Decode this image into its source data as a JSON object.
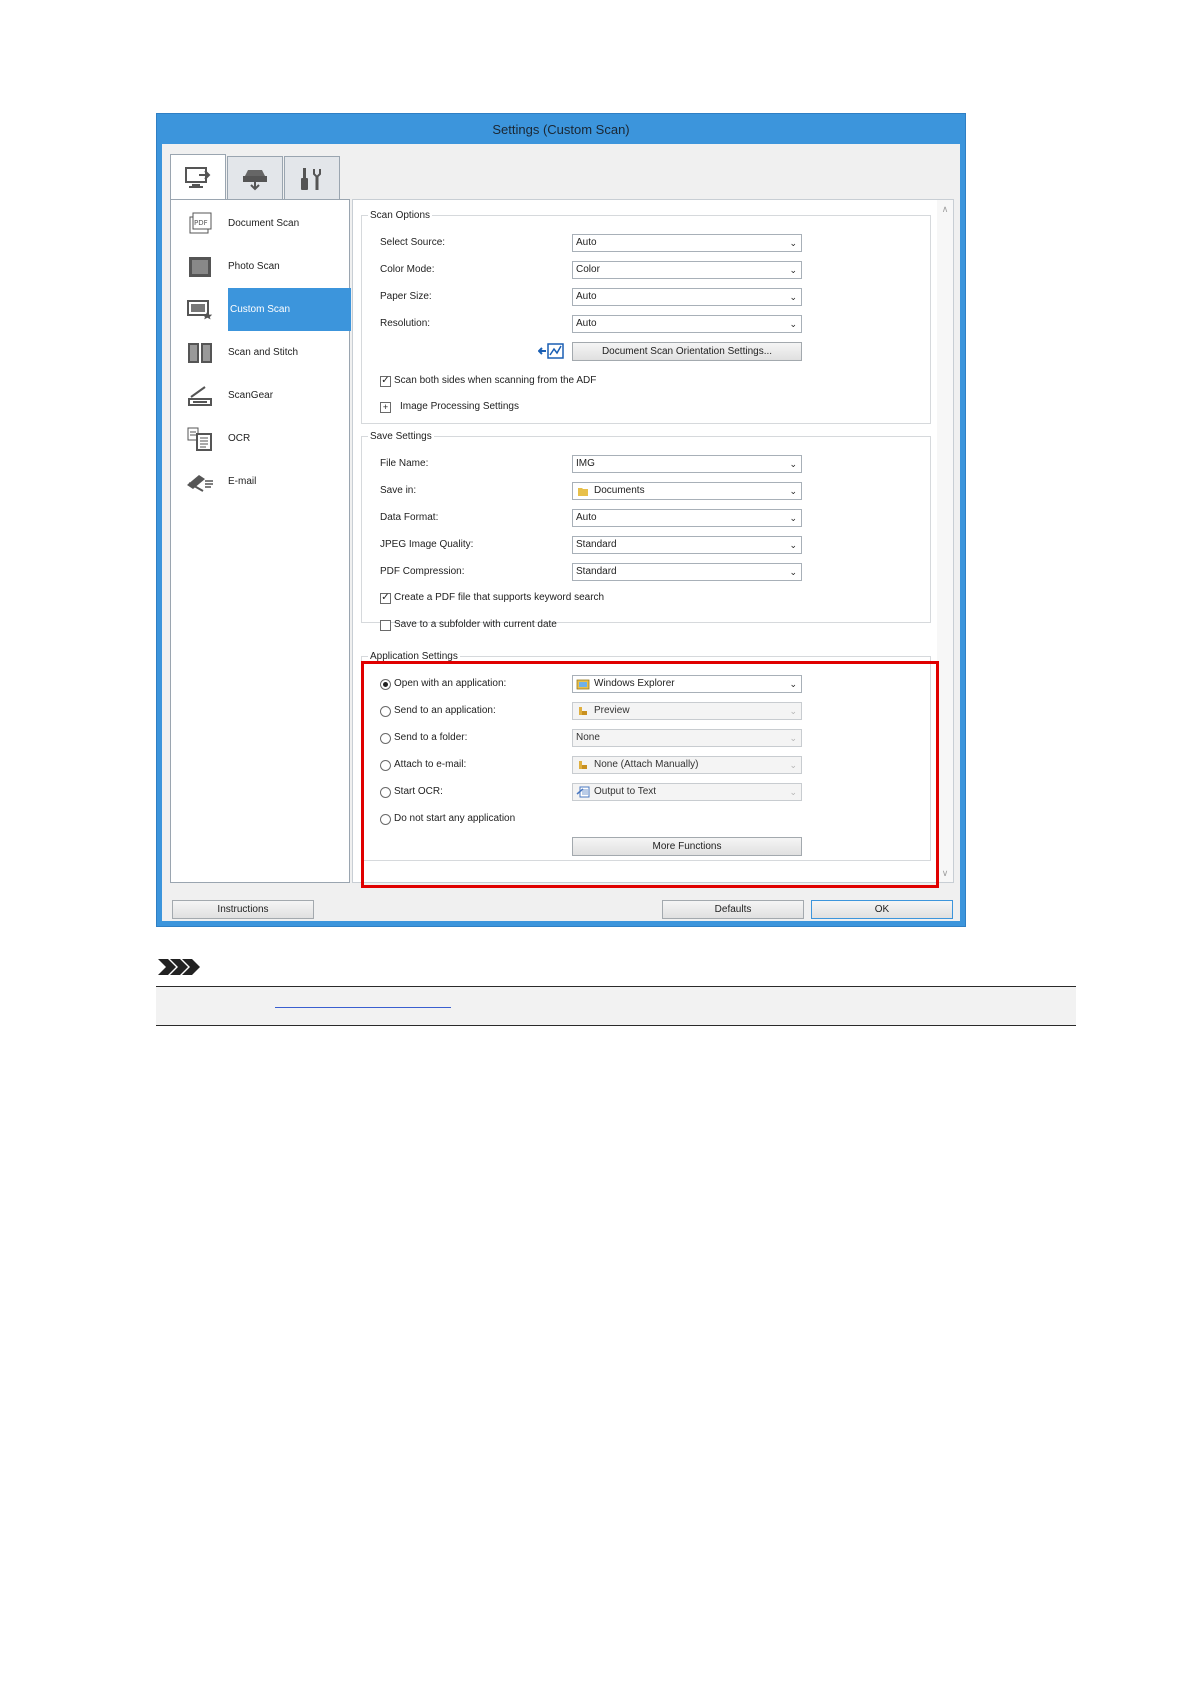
{
  "window": {
    "title": "Settings (Custom Scan)"
  },
  "tabs": [
    {
      "icon": "scan-from-computer-icon"
    },
    {
      "icon": "scan-from-operation-panel-icon"
    },
    {
      "icon": "general-settings-icon"
    }
  ],
  "sidebar": {
    "items": [
      {
        "label": "Document Scan",
        "icon": "document-scan-icon"
      },
      {
        "label": "Photo Scan",
        "icon": "photo-scan-icon"
      },
      {
        "label": "Custom Scan",
        "icon": "custom-scan-icon",
        "selected": true
      },
      {
        "label": "Scan and Stitch",
        "icon": "scan-and-stitch-icon"
      },
      {
        "label": "ScanGear",
        "icon": "scangear-icon"
      },
      {
        "label": "OCR",
        "icon": "ocr-icon"
      },
      {
        "label": "E-mail",
        "icon": "email-icon"
      }
    ]
  },
  "scan_options": {
    "legend": "Scan Options",
    "select_source": {
      "label": "Select Source:",
      "value": "Auto"
    },
    "color_mode": {
      "label": "Color Mode:",
      "value": "Color"
    },
    "paper_size": {
      "label": "Paper Size:",
      "value": "Auto"
    },
    "resolution": {
      "label": "Resolution:",
      "value": "Auto"
    },
    "orientation_button": "Document Scan Orientation Settings...",
    "scan_both_sides": {
      "label": "Scan both sides when scanning from the ADF",
      "checked": true
    },
    "image_processing": {
      "toggle": "+",
      "label": "Image Processing Settings"
    }
  },
  "save_settings": {
    "legend": "Save Settings",
    "file_name": {
      "label": "File Name:",
      "value": "IMG"
    },
    "save_in": {
      "label": "Save in:",
      "value": "Documents"
    },
    "data_format": {
      "label": "Data Format:",
      "value": "Auto"
    },
    "jpeg_quality": {
      "label": "JPEG Image Quality:",
      "value": "Standard"
    },
    "pdf_compression": {
      "label": "PDF Compression:",
      "value": "Standard"
    },
    "keyword_pdf": {
      "label": "Create a PDF file that supports keyword search",
      "checked": true
    },
    "subfolder": {
      "label": "Save to a subfolder with current date",
      "checked": false
    }
  },
  "application_settings": {
    "legend": "Application Settings",
    "open_with_app": {
      "label": "Open with an application:",
      "value": "Windows Explorer",
      "selected": true
    },
    "send_to_app": {
      "label": "Send to an application:",
      "value": "Preview"
    },
    "send_to_folder": {
      "label": "Send to a folder:",
      "value": "None"
    },
    "attach_email": {
      "label": "Attach to e-mail:",
      "value": "None (Attach Manually)"
    },
    "start_ocr": {
      "label": "Start OCR:",
      "value": "Output to Text"
    },
    "no_app": {
      "label": "Do not start any application"
    },
    "more_functions": "More Functions"
  },
  "footer": {
    "instructions": "Instructions",
    "defaults": "Defaults",
    "ok": "OK"
  },
  "colors": {
    "accent": "#3c95dc",
    "highlight": "#e00000"
  }
}
